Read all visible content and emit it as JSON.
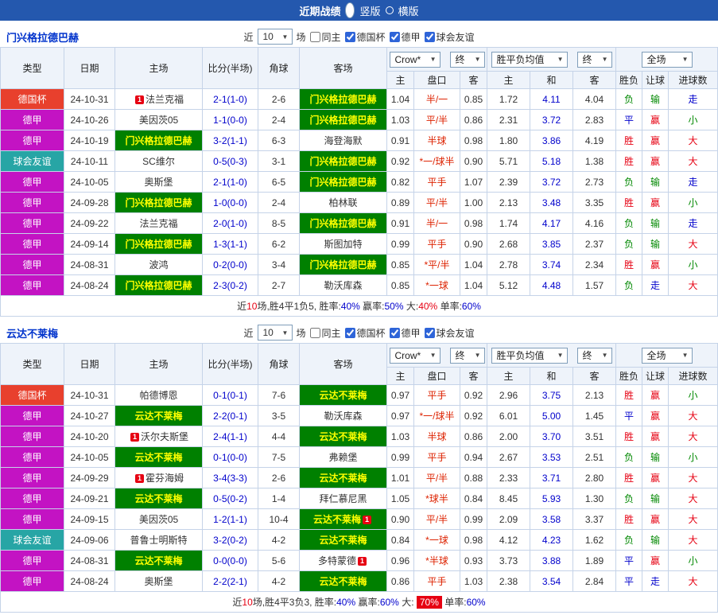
{
  "topbar": {
    "title": "近期战绩",
    "vertical_label": "竖版",
    "horizontal_label": "横版"
  },
  "controls": {
    "near_label": "近",
    "count": "10",
    "field_label": "场",
    "same_home": "同主",
    "cup": "德国杯",
    "league": "德甲",
    "friendly": "球会友谊",
    "checks": {
      "same_home": false,
      "cup": true,
      "league": true,
      "friendly": true
    }
  },
  "filters": {
    "company": "Crow*",
    "final": "终",
    "avg": "胜平负均值",
    "full": "全场"
  },
  "headers": {
    "type": "类型",
    "date": "日期",
    "home": "主场",
    "score": "比分(半场)",
    "corner": "角球",
    "away": "客场",
    "h": "主",
    "handicap": "盘口",
    "a": "客",
    "d": "和",
    "result": "胜负",
    "let": "让球",
    "goals": "进球数"
  },
  "icons": {
    "chevron_down": "▼"
  },
  "badge_text": "1",
  "colors": {
    "topbar_bg": "#2458ae",
    "title_text": "#0033cc",
    "border": "#c5d3e8",
    "header_bg": "#eef3fa",
    "cup_bg": "#e8402d",
    "league_bg": "#c313c3",
    "friendly_bg": "#27a5a5",
    "hl_bg": "#008000",
    "hl_text": "#ffff00",
    "red": "#e60012",
    "green": "#008800",
    "blue": "#0000cc",
    "score": "#0000cc",
    "handicap": "#dd2200",
    "avg_draw": "#0000cc",
    "badge_bg": "#e60012"
  },
  "sections": [
    {
      "team": "门兴格拉德巴赫",
      "rows": [
        {
          "comp": "cup",
          "comp_label": "德国杯",
          "date": "24-10-31",
          "home": "法兰克福",
          "home_badge": true,
          "home_hl": false,
          "score": "2-1(1-0)",
          "corner": "2-6",
          "away": "门兴格拉德巴赫",
          "away_badge": false,
          "away_hl": true,
          "odds_home": "1.04",
          "handicap": "半/一",
          "odds_away": "0.85",
          "avg_home": "1.72",
          "avg_draw": "4.11",
          "avg_away": "4.04",
          "result": "负",
          "handicap_result": "输",
          "goal_result": "走"
        },
        {
          "comp": "lg",
          "comp_label": "德甲",
          "date": "24-10-26",
          "home": "美因茨05",
          "home_badge": false,
          "home_hl": false,
          "score": "1-1(0-0)",
          "corner": "2-4",
          "away": "门兴格拉德巴赫",
          "away_badge": false,
          "away_hl": true,
          "odds_home": "1.03",
          "handicap": "平/半",
          "odds_away": "0.86",
          "avg_home": "2.31",
          "avg_draw": "3.72",
          "avg_away": "2.83",
          "result": "平",
          "handicap_result": "赢",
          "goal_result": "小"
        },
        {
          "comp": "lg",
          "comp_label": "德甲",
          "date": "24-10-19",
          "home": "门兴格拉德巴赫",
          "home_badge": false,
          "home_hl": true,
          "score": "3-2(1-1)",
          "corner": "6-3",
          "away": "海登海默",
          "away_badge": false,
          "away_hl": false,
          "odds_home": "0.91",
          "handicap": "半球",
          "odds_away": "0.98",
          "avg_home": "1.80",
          "avg_draw": "3.86",
          "avg_away": "4.19",
          "result": "胜",
          "handicap_result": "赢",
          "goal_result": "大"
        },
        {
          "comp": "fr",
          "comp_label": "球会友谊",
          "date": "24-10-11",
          "home": "SC维尔",
          "home_badge": false,
          "home_hl": false,
          "score": "0-5(0-3)",
          "corner": "3-1",
          "away": "门兴格拉德巴赫",
          "away_badge": false,
          "away_hl": true,
          "odds_home": "0.92",
          "handicap": "*一/球半",
          "odds_away": "0.90",
          "avg_home": "5.71",
          "avg_draw": "5.18",
          "avg_away": "1.38",
          "result": "胜",
          "handicap_result": "赢",
          "goal_result": "大"
        },
        {
          "comp": "lg",
          "comp_label": "德甲",
          "date": "24-10-05",
          "home": "奥斯堡",
          "home_badge": false,
          "home_hl": false,
          "score": "2-1(1-0)",
          "corner": "6-5",
          "away": "门兴格拉德巴赫",
          "away_badge": false,
          "away_hl": true,
          "odds_home": "0.82",
          "handicap": "平手",
          "odds_away": "1.07",
          "avg_home": "2.39",
          "avg_draw": "3.72",
          "avg_away": "2.73",
          "result": "负",
          "handicap_result": "输",
          "goal_result": "走"
        },
        {
          "comp": "lg",
          "comp_label": "德甲",
          "date": "24-09-28",
          "home": "门兴格拉德巴赫",
          "home_badge": false,
          "home_hl": true,
          "score": "1-0(0-0)",
          "corner": "2-4",
          "away": "柏林联",
          "away_badge": false,
          "away_hl": false,
          "odds_home": "0.89",
          "handicap": "平/半",
          "odds_away": "1.00",
          "avg_home": "2.13",
          "avg_draw": "3.48",
          "avg_away": "3.35",
          "result": "胜",
          "handicap_result": "赢",
          "goal_result": "小"
        },
        {
          "comp": "lg",
          "comp_label": "德甲",
          "date": "24-09-22",
          "home": "法兰克福",
          "home_badge": false,
          "home_hl": false,
          "score": "2-0(1-0)",
          "corner": "8-5",
          "away": "门兴格拉德巴赫",
          "away_badge": false,
          "away_hl": true,
          "odds_home": "0.91",
          "handicap": "半/一",
          "odds_away": "0.98",
          "avg_home": "1.74",
          "avg_draw": "4.17",
          "avg_away": "4.16",
          "result": "负",
          "handicap_result": "输",
          "goal_result": "走"
        },
        {
          "comp": "lg",
          "comp_label": "德甲",
          "date": "24-09-14",
          "home": "门兴格拉德巴赫",
          "home_badge": false,
          "home_hl": true,
          "score": "1-3(1-1)",
          "corner": "6-2",
          "away": "斯图加特",
          "away_badge": false,
          "away_hl": false,
          "odds_home": "0.99",
          "handicap": "平手",
          "odds_away": "0.90",
          "avg_home": "2.68",
          "avg_draw": "3.85",
          "avg_away": "2.37",
          "result": "负",
          "handicap_result": "输",
          "goal_result": "大"
        },
        {
          "comp": "lg",
          "comp_label": "德甲",
          "date": "24-08-31",
          "home": "波鸿",
          "home_badge": false,
          "home_hl": false,
          "score": "0-2(0-0)",
          "corner": "3-4",
          "away": "门兴格拉德巴赫",
          "away_badge": false,
          "away_hl": true,
          "odds_home": "0.85",
          "handicap": "*平/半",
          "odds_away": "1.04",
          "avg_home": "2.78",
          "avg_draw": "3.74",
          "avg_away": "2.34",
          "result": "胜",
          "handicap_result": "赢",
          "goal_result": "小"
        },
        {
          "comp": "lg",
          "comp_label": "德甲",
          "date": "24-08-24",
          "home": "门兴格拉德巴赫",
          "home_badge": false,
          "home_hl": true,
          "score": "2-3(0-2)",
          "corner": "2-7",
          "away": "勒沃库森",
          "away_badge": false,
          "away_hl": false,
          "odds_home": "0.85",
          "handicap": "*一球",
          "odds_away": "1.04",
          "avg_home": "5.12",
          "avg_draw": "4.48",
          "avg_away": "1.57",
          "result": "负",
          "handicap_result": "走",
          "goal_result": "大"
        }
      ],
      "summary": [
        {
          "t": "近",
          "c": ""
        },
        {
          "t": "10",
          "c": "red"
        },
        {
          "t": "场,胜4平1负5, 胜率:",
          "c": ""
        },
        {
          "t": "40%",
          "c": "blue"
        },
        {
          "t": " 赢率:",
          "c": ""
        },
        {
          "t": "50%",
          "c": "blue"
        },
        {
          "t": " 大:",
          "c": ""
        },
        {
          "t": "40%",
          "c": "red"
        },
        {
          "t": " 单率:",
          "c": ""
        },
        {
          "t": "60%",
          "c": "blue"
        }
      ]
    },
    {
      "team": "云达不莱梅",
      "rows": [
        {
          "comp": "cup",
          "comp_label": "德国杯",
          "date": "24-10-31",
          "home": "帕德博恩",
          "home_badge": false,
          "home_hl": false,
          "score": "0-1(0-1)",
          "corner": "7-6",
          "away": "云达不莱梅",
          "away_badge": false,
          "away_hl": true,
          "odds_home": "0.97",
          "handicap": "平手",
          "odds_away": "0.92",
          "avg_home": "2.96",
          "avg_draw": "3.75",
          "avg_away": "2.13",
          "result": "胜",
          "handicap_result": "赢",
          "goal_result": "小"
        },
        {
          "comp": "lg",
          "comp_label": "德甲",
          "date": "24-10-27",
          "home": "云达不莱梅",
          "home_badge": false,
          "home_hl": true,
          "score": "2-2(0-1)",
          "corner": "3-5",
          "away": "勒沃库森",
          "away_badge": false,
          "away_hl": false,
          "odds_home": "0.97",
          "handicap": "*一/球半",
          "odds_away": "0.92",
          "avg_home": "6.01",
          "avg_draw": "5.00",
          "avg_away": "1.45",
          "result": "平",
          "handicap_result": "赢",
          "goal_result": "大"
        },
        {
          "comp": "lg",
          "comp_label": "德甲",
          "date": "24-10-20",
          "home": "沃尔夫斯堡",
          "home_badge": true,
          "home_hl": false,
          "score": "2-4(1-1)",
          "corner": "4-4",
          "away": "云达不莱梅",
          "away_badge": false,
          "away_hl": true,
          "odds_home": "1.03",
          "handicap": "半球",
          "odds_away": "0.86",
          "avg_home": "2.00",
          "avg_draw": "3.70",
          "avg_away": "3.51",
          "result": "胜",
          "handicap_result": "赢",
          "goal_result": "大"
        },
        {
          "comp": "lg",
          "comp_label": "德甲",
          "date": "24-10-05",
          "home": "云达不莱梅",
          "home_badge": false,
          "home_hl": true,
          "score": "0-1(0-0)",
          "corner": "7-5",
          "away": "弗赖堡",
          "away_badge": false,
          "away_hl": false,
          "odds_home": "0.99",
          "handicap": "平手",
          "odds_away": "0.94",
          "avg_home": "2.67",
          "avg_draw": "3.53",
          "avg_away": "2.51",
          "result": "负",
          "handicap_result": "输",
          "goal_result": "小"
        },
        {
          "comp": "lg",
          "comp_label": "德甲",
          "date": "24-09-29",
          "home": "霍芬海姆",
          "home_badge": true,
          "home_hl": false,
          "score": "3-4(3-3)",
          "corner": "2-6",
          "away": "云达不莱梅",
          "away_badge": false,
          "away_hl": true,
          "odds_home": "1.01",
          "handicap": "平/半",
          "odds_away": "0.88",
          "avg_home": "2.33",
          "avg_draw": "3.71",
          "avg_away": "2.80",
          "result": "胜",
          "handicap_result": "赢",
          "goal_result": "大"
        },
        {
          "comp": "lg",
          "comp_label": "德甲",
          "date": "24-09-21",
          "home": "云达不莱梅",
          "home_badge": false,
          "home_hl": true,
          "score": "0-5(0-2)",
          "corner": "1-4",
          "away": "拜仁慕尼黑",
          "away_badge": false,
          "away_hl": false,
          "odds_home": "1.05",
          "handicap": "*球半",
          "odds_away": "0.84",
          "avg_home": "8.45",
          "avg_draw": "5.93",
          "avg_away": "1.30",
          "result": "负",
          "handicap_result": "输",
          "goal_result": "大"
        },
        {
          "comp": "lg",
          "comp_label": "德甲",
          "date": "24-09-15",
          "home": "美因茨05",
          "home_badge": false,
          "home_hl": false,
          "score": "1-2(1-1)",
          "corner": "10-4",
          "away": "云达不莱梅",
          "away_badge": true,
          "away_hl": true,
          "odds_home": "0.90",
          "handicap": "平/半",
          "odds_away": "0.99",
          "avg_home": "2.09",
          "avg_draw": "3.58",
          "avg_away": "3.37",
          "result": "胜",
          "handicap_result": "赢",
          "goal_result": "大"
        },
        {
          "comp": "fr",
          "comp_label": "球会友谊",
          "date": "24-09-06",
          "home": "普鲁士明斯特",
          "home_badge": false,
          "home_hl": false,
          "score": "3-2(0-2)",
          "corner": "4-2",
          "away": "云达不莱梅",
          "away_badge": false,
          "away_hl": true,
          "odds_home": "0.84",
          "handicap": "*一球",
          "odds_away": "0.98",
          "avg_home": "4.12",
          "avg_draw": "4.23",
          "avg_away": "1.62",
          "result": "负",
          "handicap_result": "输",
          "goal_result": "大"
        },
        {
          "comp": "lg",
          "comp_label": "德甲",
          "date": "24-08-31",
          "home": "云达不莱梅",
          "home_badge": false,
          "home_hl": true,
          "score": "0-0(0-0)",
          "corner": "5-6",
          "away": "多特蒙德",
          "away_badge": true,
          "away_hl": false,
          "odds_home": "0.96",
          "handicap": "*半球",
          "odds_away": "0.93",
          "avg_home": "3.73",
          "avg_draw": "3.88",
          "avg_away": "1.89",
          "result": "平",
          "handicap_result": "赢",
          "goal_result": "小"
        },
        {
          "comp": "lg",
          "comp_label": "德甲",
          "date": "24-08-24",
          "home": "奥斯堡",
          "home_badge": false,
          "home_hl": false,
          "score": "2-2(2-1)",
          "corner": "4-2",
          "away": "云达不莱梅",
          "away_badge": false,
          "away_hl": true,
          "odds_home": "0.86",
          "handicap": "平手",
          "odds_away": "1.03",
          "avg_home": "2.38",
          "avg_draw": "3.54",
          "avg_away": "2.84",
          "result": "平",
          "handicap_result": "走",
          "goal_result": "大"
        }
      ],
      "summary": [
        {
          "t": "近",
          "c": ""
        },
        {
          "t": "10",
          "c": "red"
        },
        {
          "t": "场,胜4平3负3, 胜率:",
          "c": ""
        },
        {
          "t": "40%",
          "c": "blue"
        },
        {
          "t": " 赢率:",
          "c": ""
        },
        {
          "t": "60%",
          "c": "blue"
        },
        {
          "t": " 大: ",
          "c": ""
        },
        {
          "t": "70%",
          "c": "redbg"
        },
        {
          "t": " 单率:",
          "c": ""
        },
        {
          "t": "60%",
          "c": "blue"
        }
      ]
    }
  ]
}
